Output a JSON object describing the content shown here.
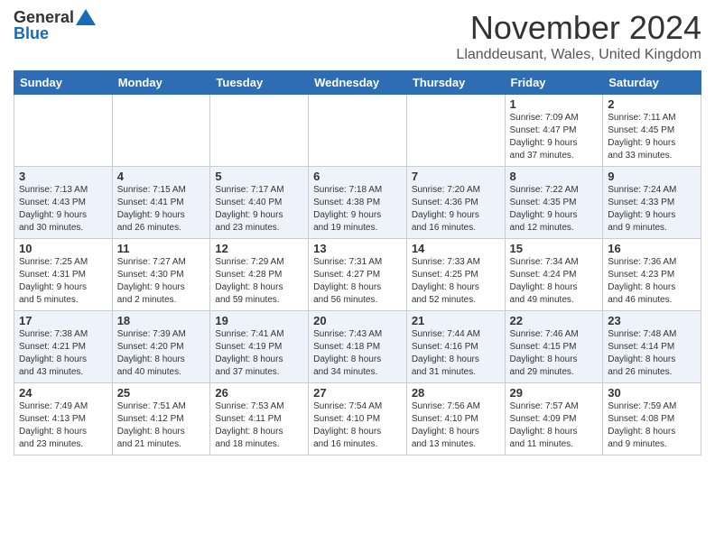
{
  "header": {
    "logo_general": "General",
    "logo_blue": "Blue",
    "month_title": "November 2024",
    "location": "Llanddeusant, Wales, United Kingdom"
  },
  "days_of_week": [
    "Sunday",
    "Monday",
    "Tuesday",
    "Wednesday",
    "Thursday",
    "Friday",
    "Saturday"
  ],
  "weeks": [
    [
      {
        "day": "",
        "detail": ""
      },
      {
        "day": "",
        "detail": ""
      },
      {
        "day": "",
        "detail": ""
      },
      {
        "day": "",
        "detail": ""
      },
      {
        "day": "",
        "detail": ""
      },
      {
        "day": "1",
        "detail": "Sunrise: 7:09 AM\nSunset: 4:47 PM\nDaylight: 9 hours\nand 37 minutes."
      },
      {
        "day": "2",
        "detail": "Sunrise: 7:11 AM\nSunset: 4:45 PM\nDaylight: 9 hours\nand 33 minutes."
      }
    ],
    [
      {
        "day": "3",
        "detail": "Sunrise: 7:13 AM\nSunset: 4:43 PM\nDaylight: 9 hours\nand 30 minutes."
      },
      {
        "day": "4",
        "detail": "Sunrise: 7:15 AM\nSunset: 4:41 PM\nDaylight: 9 hours\nand 26 minutes."
      },
      {
        "day": "5",
        "detail": "Sunrise: 7:17 AM\nSunset: 4:40 PM\nDaylight: 9 hours\nand 23 minutes."
      },
      {
        "day": "6",
        "detail": "Sunrise: 7:18 AM\nSunset: 4:38 PM\nDaylight: 9 hours\nand 19 minutes."
      },
      {
        "day": "7",
        "detail": "Sunrise: 7:20 AM\nSunset: 4:36 PM\nDaylight: 9 hours\nand 16 minutes."
      },
      {
        "day": "8",
        "detail": "Sunrise: 7:22 AM\nSunset: 4:35 PM\nDaylight: 9 hours\nand 12 minutes."
      },
      {
        "day": "9",
        "detail": "Sunrise: 7:24 AM\nSunset: 4:33 PM\nDaylight: 9 hours\nand 9 minutes."
      }
    ],
    [
      {
        "day": "10",
        "detail": "Sunrise: 7:25 AM\nSunset: 4:31 PM\nDaylight: 9 hours\nand 5 minutes."
      },
      {
        "day": "11",
        "detail": "Sunrise: 7:27 AM\nSunset: 4:30 PM\nDaylight: 9 hours\nand 2 minutes."
      },
      {
        "day": "12",
        "detail": "Sunrise: 7:29 AM\nSunset: 4:28 PM\nDaylight: 8 hours\nand 59 minutes."
      },
      {
        "day": "13",
        "detail": "Sunrise: 7:31 AM\nSunset: 4:27 PM\nDaylight: 8 hours\nand 56 minutes."
      },
      {
        "day": "14",
        "detail": "Sunrise: 7:33 AM\nSunset: 4:25 PM\nDaylight: 8 hours\nand 52 minutes."
      },
      {
        "day": "15",
        "detail": "Sunrise: 7:34 AM\nSunset: 4:24 PM\nDaylight: 8 hours\nand 49 minutes."
      },
      {
        "day": "16",
        "detail": "Sunrise: 7:36 AM\nSunset: 4:23 PM\nDaylight: 8 hours\nand 46 minutes."
      }
    ],
    [
      {
        "day": "17",
        "detail": "Sunrise: 7:38 AM\nSunset: 4:21 PM\nDaylight: 8 hours\nand 43 minutes."
      },
      {
        "day": "18",
        "detail": "Sunrise: 7:39 AM\nSunset: 4:20 PM\nDaylight: 8 hours\nand 40 minutes."
      },
      {
        "day": "19",
        "detail": "Sunrise: 7:41 AM\nSunset: 4:19 PM\nDaylight: 8 hours\nand 37 minutes."
      },
      {
        "day": "20",
        "detail": "Sunrise: 7:43 AM\nSunset: 4:18 PM\nDaylight: 8 hours\nand 34 minutes."
      },
      {
        "day": "21",
        "detail": "Sunrise: 7:44 AM\nSunset: 4:16 PM\nDaylight: 8 hours\nand 31 minutes."
      },
      {
        "day": "22",
        "detail": "Sunrise: 7:46 AM\nSunset: 4:15 PM\nDaylight: 8 hours\nand 29 minutes."
      },
      {
        "day": "23",
        "detail": "Sunrise: 7:48 AM\nSunset: 4:14 PM\nDaylight: 8 hours\nand 26 minutes."
      }
    ],
    [
      {
        "day": "24",
        "detail": "Sunrise: 7:49 AM\nSunset: 4:13 PM\nDaylight: 8 hours\nand 23 minutes."
      },
      {
        "day": "25",
        "detail": "Sunrise: 7:51 AM\nSunset: 4:12 PM\nDaylight: 8 hours\nand 21 minutes."
      },
      {
        "day": "26",
        "detail": "Sunrise: 7:53 AM\nSunset: 4:11 PM\nDaylight: 8 hours\nand 18 minutes."
      },
      {
        "day": "27",
        "detail": "Sunrise: 7:54 AM\nSunset: 4:10 PM\nDaylight: 8 hours\nand 16 minutes."
      },
      {
        "day": "28",
        "detail": "Sunrise: 7:56 AM\nSunset: 4:10 PM\nDaylight: 8 hours\nand 13 minutes."
      },
      {
        "day": "29",
        "detail": "Sunrise: 7:57 AM\nSunset: 4:09 PM\nDaylight: 8 hours\nand 11 minutes."
      },
      {
        "day": "30",
        "detail": "Sunrise: 7:59 AM\nSunset: 4:08 PM\nDaylight: 8 hours\nand 9 minutes."
      }
    ]
  ]
}
